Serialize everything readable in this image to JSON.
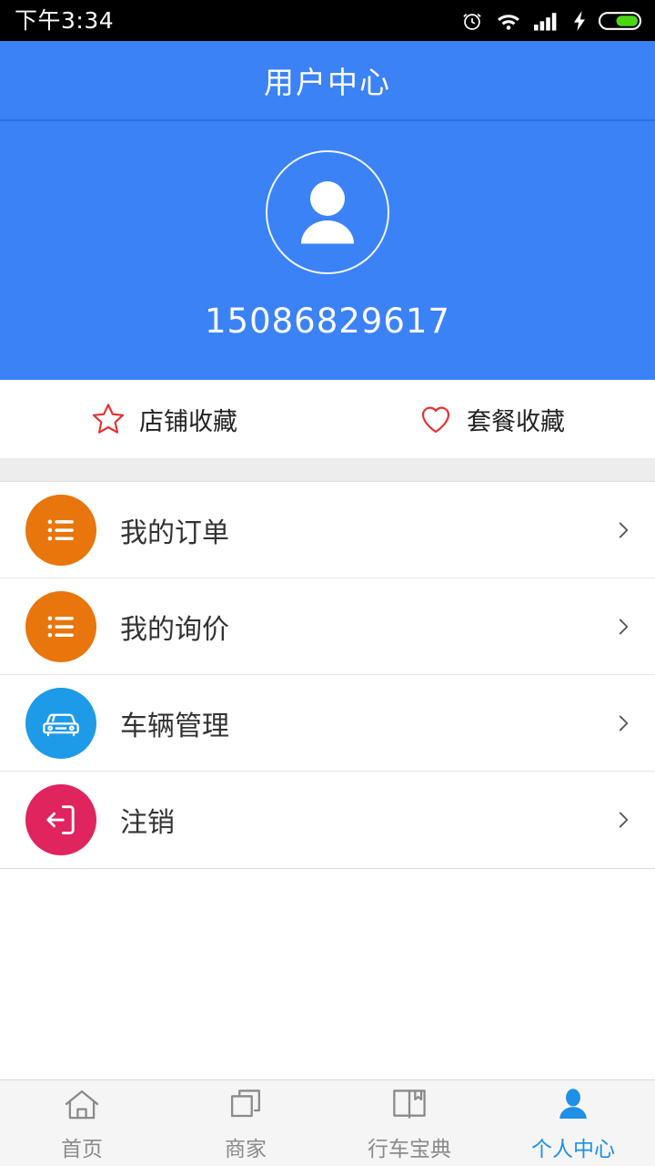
{
  "status_bar": {
    "time": "下午3:34",
    "icons": [
      "alarm-icon",
      "wifi-icon",
      "signal-icon",
      "charging-bolt-icon",
      "battery-icon"
    ],
    "battery_level_percent": 60
  },
  "header": {
    "title": "用户中心",
    "background_color": "#3b82f6"
  },
  "profile": {
    "avatar_icon": "person-avatar-icon",
    "phone_number": "15086829617"
  },
  "favorites": [
    {
      "icon": "star-outline-icon",
      "label": "店铺收藏",
      "color": "#e8302f"
    },
    {
      "icon": "heart-outline-icon",
      "label": "套餐收藏",
      "color": "#e8302f"
    }
  ],
  "menu": [
    {
      "icon": "list-lines-icon",
      "label": "我的订单",
      "icon_bg": "#e8760d",
      "chevron": "chevron-right-icon"
    },
    {
      "icon": "list-lines-icon",
      "label": "我的询价",
      "icon_bg": "#e8760d",
      "chevron": "chevron-right-icon"
    },
    {
      "icon": "car-front-icon",
      "label": "车辆管理",
      "icon_bg": "#1e9be8",
      "chevron": "chevron-right-icon"
    },
    {
      "icon": "logout-exit-icon",
      "label": "注销",
      "icon_bg": "#e0245e",
      "chevron": "chevron-right-icon"
    }
  ],
  "tab_bar": {
    "active_color": "#1e90e8",
    "inactive_color": "#8a8a8a",
    "tabs": [
      {
        "icon": "home-icon",
        "label": "首页",
        "active": false
      },
      {
        "icon": "shops-stacked-squares-icon",
        "label": "商家",
        "active": false
      },
      {
        "icon": "open-book-icon",
        "label": "行车宝典",
        "active": false
      },
      {
        "icon": "person-icon",
        "label": "个人中心",
        "active": true
      }
    ]
  }
}
